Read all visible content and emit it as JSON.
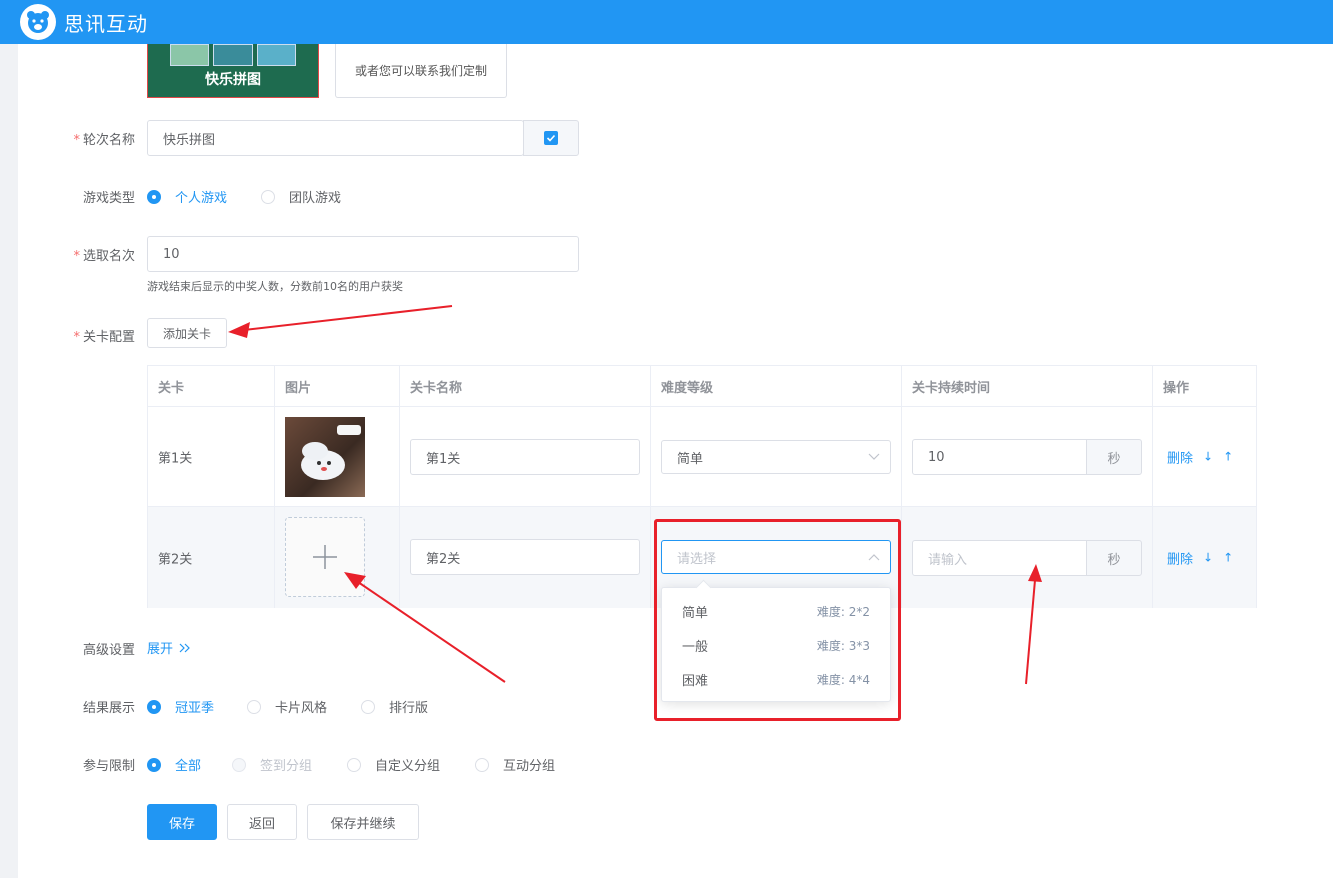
{
  "header": {
    "app_title": "思讯互动"
  },
  "template": {
    "selected_name": "快乐拼图",
    "custom_text": "或者您可以联系我们定制"
  },
  "form": {
    "round_name": {
      "label": "轮次名称",
      "value": "快乐拼图"
    },
    "game_type": {
      "label": "游戏类型",
      "options": [
        "个人游戏",
        "团队游戏"
      ],
      "selected": "个人游戏"
    },
    "rank": {
      "label": "选取名次",
      "value": "10",
      "hint": "游戏结束后显示的中奖人数，分数前10名的用户获奖"
    },
    "levels": {
      "label": "关卡配置",
      "add_button": "添加关卡"
    },
    "advanced": {
      "label": "高级设置",
      "expand": "展开"
    },
    "result": {
      "label": "结果展示",
      "options": [
        "冠亚季",
        "卡片风格",
        "排行版"
      ],
      "selected": "冠亚季"
    },
    "limit": {
      "label": "参与限制",
      "options": [
        "全部",
        "签到分组",
        "自定义分组",
        "互动分组"
      ],
      "selected": "全部",
      "disabled": "签到分组"
    }
  },
  "table": {
    "headers": [
      "关卡",
      "图片",
      "关卡名称",
      "难度等级",
      "关卡持续时间",
      "操作"
    ],
    "rows": [
      {
        "level": "第1关",
        "name": "第1关",
        "difficulty": "简单",
        "duration": "10",
        "unit": "秒",
        "delete": "删除"
      },
      {
        "level": "第2关",
        "name": "第2关",
        "difficulty_placeholder": "请选择",
        "duration_placeholder": "请输入",
        "unit": "秒",
        "delete": "删除"
      }
    ]
  },
  "dropdown": {
    "options": [
      {
        "label": "简单",
        "meta": "难度: 2*2"
      },
      {
        "label": "一般",
        "meta": "难度: 3*3"
      },
      {
        "label": "困难",
        "meta": "难度: 4*4"
      }
    ]
  },
  "buttons": {
    "save": "保存",
    "back": "返回",
    "save_continue": "保存并继续"
  },
  "colors": {
    "primary": "#2196f3",
    "required": "#f56c6c",
    "annotation": "#e8202a"
  }
}
